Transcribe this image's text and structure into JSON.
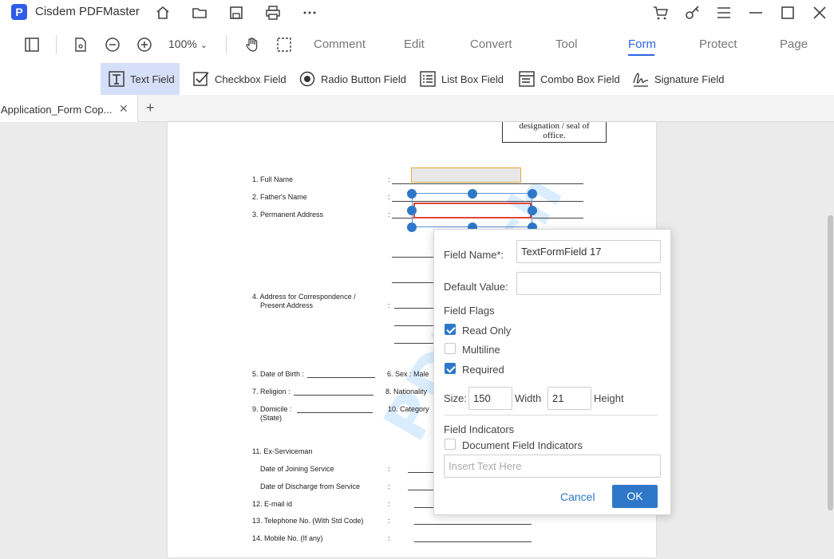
{
  "titlebar": {
    "app_logo": "P",
    "title": "Cisdem PDFMaster"
  },
  "toolbar": {
    "zoom": "100%",
    "menu": [
      "Comment",
      "Edit",
      "Convert",
      "Tool",
      "Form",
      "Protect",
      "Page"
    ],
    "active_menu": "Form"
  },
  "subtoolbar": {
    "tools": [
      "Text Field",
      "Checkbox Field",
      "Radio Button Field",
      "List Box Field",
      "Combo Box Field",
      "Signature Field"
    ],
    "active_tool": "Text Field"
  },
  "tab": {
    "label": "Application_Form Cop...",
    "close": "✕",
    "add": "+"
  },
  "document": {
    "seal_text_1": "designation / seal of",
    "seal_text_2": "office.",
    "watermark": "PDFTech",
    "fields": {
      "f1": "1. Full Name",
      "f2": "2. Father's Name",
      "f3": "3. Permanent Address",
      "f4a": "4. Address for Correspondence /",
      "f4b": "Present Address",
      "f5": "5. Date of Birth :",
      "f6": "6.  Sex : Male",
      "f7": "7. Religion :",
      "f8": "8.   Nationality",
      "f9a": "9. Domicile :",
      "f9b": "(State)",
      "f10": "10.   Category",
      "f11": "11. Ex-Serviceman",
      "f11a": "Date of Joining Service",
      "f11b": "Date of Discharge from Service",
      "f12": "12. E-mail id",
      "f13": "13. Telephone No. (With Std Code)",
      "f14": "14. Mobile No.   (If any)",
      "colon": ":"
    }
  },
  "dialog": {
    "field_name_label": "Field Name*:",
    "field_name_value": "TextFormField 17",
    "default_value_label": "Default Value:",
    "default_value": "",
    "flags_title": "Field Flags",
    "flags": [
      {
        "label": "Read Only",
        "checked": true
      },
      {
        "label": "Multiline",
        "checked": false
      },
      {
        "label": "Required",
        "checked": true
      }
    ],
    "size_label": "Size:",
    "width_value": "150",
    "width_label": "Width",
    "height_value": "21",
    "height_label": "Height",
    "indicators_title": "Field Indicators",
    "doc_indicators_label": "Document Field Indicators",
    "doc_indicators_checked": false,
    "text_placeholder": "Insert Text Here",
    "cancel": "Cancel",
    "ok": "OK"
  }
}
